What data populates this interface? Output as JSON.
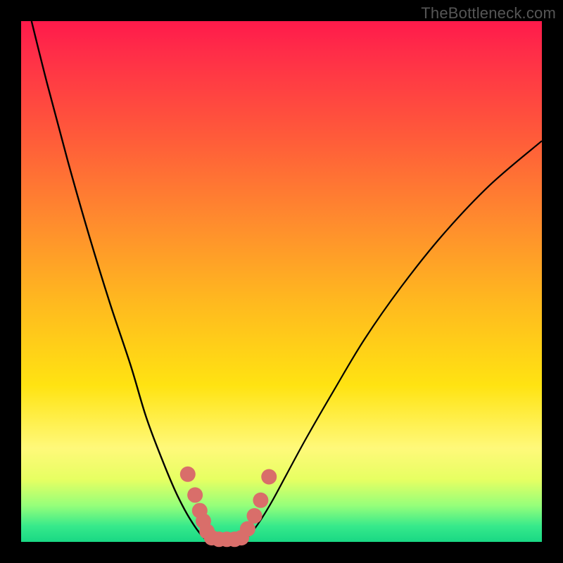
{
  "watermark": "TheBottleneck.com",
  "colors": {
    "background": "#000000",
    "gradient_top": "#ff1a4b",
    "gradient_mid_orange": "#ff8a2e",
    "gradient_mid_yellow": "#ffe312",
    "gradient_bottom": "#19d884",
    "curve": "#000000",
    "marker": "#d96e6a"
  },
  "chart_data": {
    "type": "line",
    "title": "",
    "xlabel": "",
    "ylabel": "",
    "xlim": [
      0,
      100
    ],
    "ylim": [
      0,
      100
    ],
    "grid": false,
    "legend": false,
    "annotations": [
      "TheBottleneck.com"
    ],
    "series": [
      {
        "name": "left-curve",
        "x": [
          2,
          5,
          9,
          13,
          17,
          21,
          24,
          27,
          29.5,
          31.5,
          33,
          34.2,
          35.3,
          36.3
        ],
        "y": [
          100,
          88,
          73,
          59,
          46,
          34,
          24,
          16,
          10,
          6,
          3.5,
          1.8,
          0.6,
          0
        ]
      },
      {
        "name": "right-curve",
        "x": [
          42.5,
          43.4,
          44.6,
          46.2,
          48.3,
          51,
          54.8,
          60,
          66,
          73,
          81,
          90,
          100
        ],
        "y": [
          0,
          0.8,
          2.2,
          4.5,
          8,
          13,
          20,
          29,
          39,
          49,
          59,
          68.5,
          77
        ]
      },
      {
        "name": "valley-floor",
        "x": [
          36.3,
          42.5
        ],
        "y": [
          0,
          0
        ]
      }
    ],
    "markers": [
      {
        "name": "left-upper",
        "x": 32.0,
        "y": 13.0,
        "r": 1.7
      },
      {
        "name": "left-mid",
        "x": 33.4,
        "y": 9.0,
        "r": 1.7
      },
      {
        "name": "left-lower-a",
        "x": 34.3,
        "y": 6.0,
        "r": 1.6
      },
      {
        "name": "left-lower-b",
        "x": 35.0,
        "y": 4.0,
        "r": 1.6
      },
      {
        "name": "left-lower-c",
        "x": 35.7,
        "y": 2.0,
        "r": 1.6
      },
      {
        "name": "floor-a",
        "x": 36.6,
        "y": 0.8,
        "r": 1.6
      },
      {
        "name": "floor-b",
        "x": 38.0,
        "y": 0.5,
        "r": 1.6
      },
      {
        "name": "floor-c",
        "x": 39.5,
        "y": 0.5,
        "r": 1.6
      },
      {
        "name": "floor-d",
        "x": 41.0,
        "y": 0.5,
        "r": 1.6
      },
      {
        "name": "floor-e",
        "x": 42.3,
        "y": 0.8,
        "r": 1.6
      },
      {
        "name": "right-lower-a",
        "x": 43.5,
        "y": 2.5,
        "r": 1.6
      },
      {
        "name": "right-lower-b",
        "x": 44.8,
        "y": 5.0,
        "r": 1.6
      },
      {
        "name": "right-mid",
        "x": 46.0,
        "y": 8.0,
        "r": 1.7
      },
      {
        "name": "right-upper",
        "x": 47.6,
        "y": 12.5,
        "r": 1.7
      }
    ]
  }
}
